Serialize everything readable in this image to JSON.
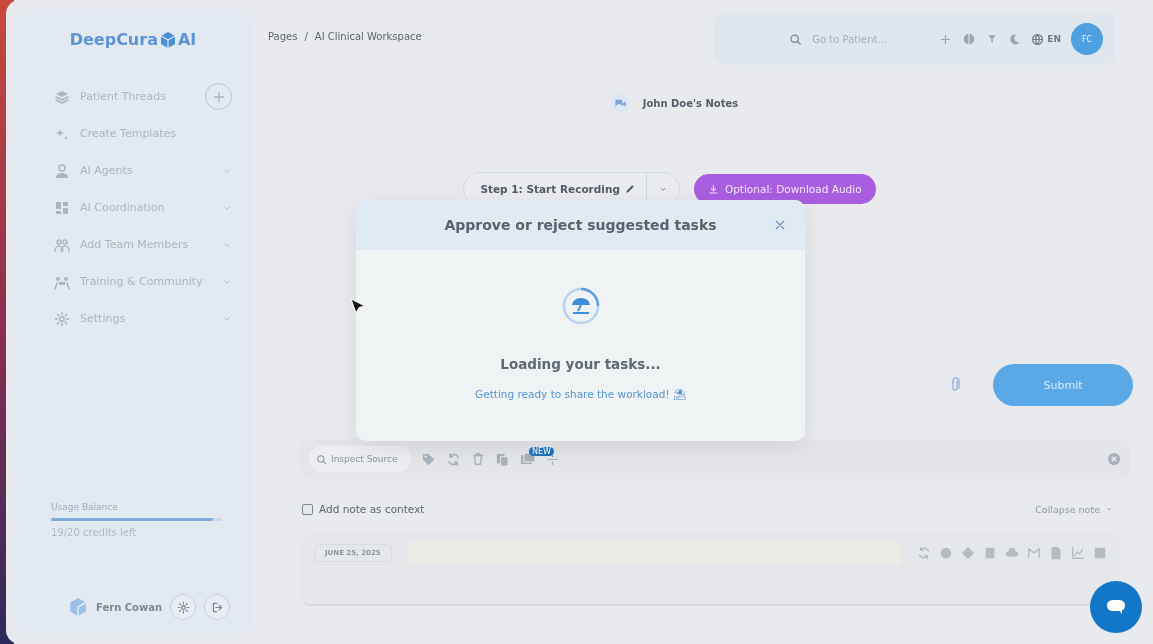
{
  "sidebar": {
    "logo": {
      "name": "DeepCura",
      "suffix": "AI"
    },
    "items": [
      {
        "label": "Patient Threads",
        "kind": "add"
      },
      {
        "label": "Create Templates",
        "kind": "plain"
      },
      {
        "label": "AI Agents",
        "kind": "menu",
        "expanded": false
      },
      {
        "label": "AI Coordination",
        "kind": "menu",
        "expanded": false
      },
      {
        "label": "Add Team Members",
        "kind": "menu",
        "expanded": false
      },
      {
        "label": "Training & Community",
        "kind": "menu",
        "expanded": false
      },
      {
        "label": "Settings",
        "kind": "menu",
        "expanded": false
      }
    ],
    "usage": {
      "title": "Usage Balance",
      "level": 0.95,
      "reading": "19/20 credits left"
    },
    "user": {
      "name": "Fern Cowan"
    }
  },
  "header": {
    "breadcrumb": [
      "Pages",
      "AI Clinical Workspace"
    ],
    "breadcrumb_separator": "/",
    "search": {
      "placeholder": "Go to Patient..."
    },
    "language": "EN",
    "avatar": "FC"
  },
  "notes_tab": {
    "label": "John Doe's Notes"
  },
  "record": {
    "step_button": "Step 1: Start Recording",
    "download_button": "Optional: Download Audio"
  },
  "submit_button": "Submit",
  "source_bar": {
    "search": {
      "placeholder": "Inspect Source"
    },
    "badge": "NEW"
  },
  "context_checkbox": {
    "label": "Add note as context",
    "checked": false
  },
  "collapse_link": "Collapse note",
  "note": {
    "date": "JUNE 25, 2025"
  },
  "modal": {
    "title": "Approve or reject suggested tasks",
    "loading": "Loading your tasks...",
    "subtitle": "Getting ready to share the workload! ⛱"
  }
}
